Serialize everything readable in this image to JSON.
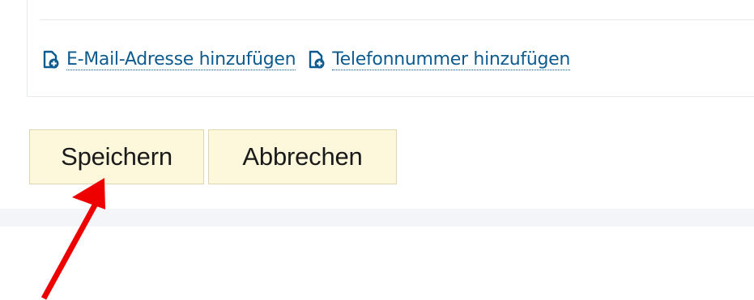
{
  "contact_actions": {
    "add_email_label": "E-Mail-Adresse hinzufügen",
    "add_phone_label": "Telefonnummer hinzufügen",
    "icon": "add-document-icon"
  },
  "form_actions": {
    "save_label": "Speichern",
    "cancel_label": "Abbrechen"
  },
  "annotation": {
    "type": "arrow",
    "color": "#ee0000",
    "points_to": "save-button"
  },
  "colors": {
    "link": "#0d5b8f",
    "button_background": "#fdf8dc",
    "button_border": "#ddd6ae"
  }
}
